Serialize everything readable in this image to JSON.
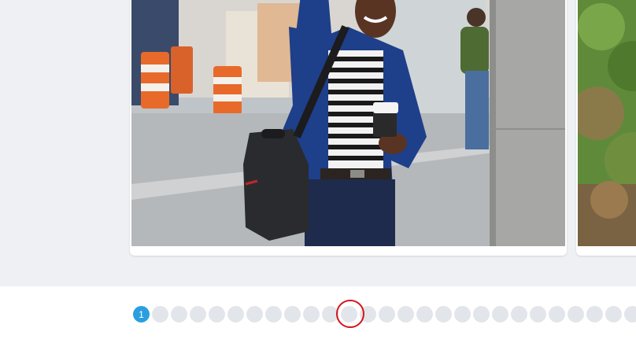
{
  "carousel": {
    "current_slide_image": "photo-man-waving-street",
    "next_slide_image": "photo-greenery"
  },
  "pagination": {
    "active_label": "1",
    "dots": [
      "1",
      "",
      "",
      "",
      "",
      "",
      "",
      "",
      "",
      "",
      "",
      "",
      "",
      "",
      "",
      "",
      "",
      "",
      "",
      "",
      "",
      "",
      "",
      "",
      "",
      "",
      "",
      ""
    ]
  },
  "colors": {
    "active_dot": "#2a9fe0",
    "inactive_dot": "#e2e5ea",
    "focus_ring": "#d6141c"
  }
}
